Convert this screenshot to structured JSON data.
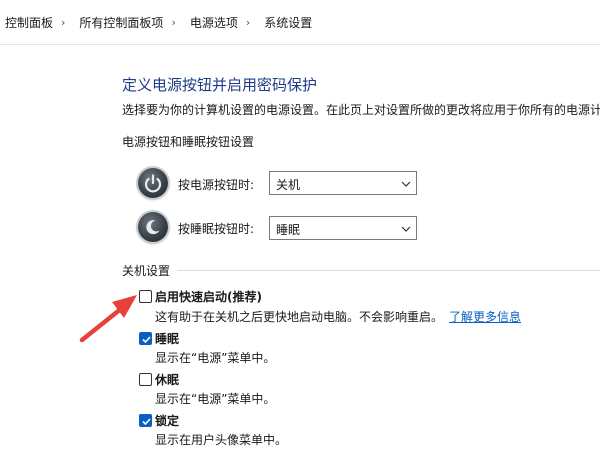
{
  "breadcrumb": {
    "items": [
      "控制面板",
      "所有控制面板项",
      "电源选项",
      "系统设置"
    ],
    "separator": "›"
  },
  "page": {
    "title": "定义电源按钮并启用密码保护",
    "description": "选择要为你的计算机设置的电源设置。在此页上对设置所做的更改将应用于你所有的电源计"
  },
  "power_buttons": {
    "section_label": "电源按钮和睡眠按钮设置",
    "rows": [
      {
        "label": "按电源按钮时:",
        "value": "关机",
        "icon": "power-button-icon"
      },
      {
        "label": "按睡眠按钮时:",
        "value": "睡眠",
        "icon": "sleep-button-icon"
      }
    ]
  },
  "shutdown": {
    "section_label": "关机设置",
    "options": [
      {
        "label": "启用快速启动(推荐)",
        "checked": false,
        "desc": "这有助于在关机之后更快地启动电脑。不会影响重启。",
        "link": "了解更多信息"
      },
      {
        "label": "睡眠",
        "checked": true,
        "desc": "显示在“电源”菜单中。"
      },
      {
        "label": "休眠",
        "checked": false,
        "desc": "显示在“电源”菜单中。"
      },
      {
        "label": "锁定",
        "checked": true,
        "desc": "显示在用户头像菜单中。"
      }
    ]
  },
  "colors": {
    "title": "#1e3a8a",
    "link": "#0a5fc4",
    "checkbox_checked": "#0a5fc4",
    "annotation_arrow": "#e8403a"
  }
}
